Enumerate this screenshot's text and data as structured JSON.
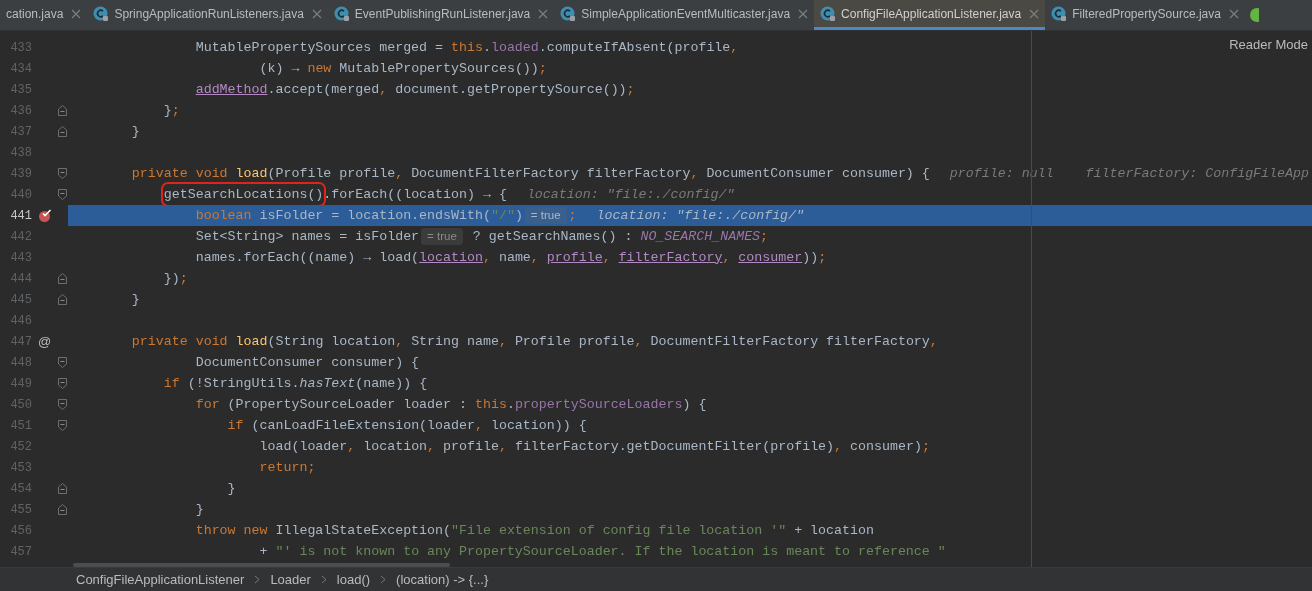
{
  "tabs": [
    {
      "label": "cation.java",
      "selected": false,
      "icon": false
    },
    {
      "label": "SpringApplicationRunListeners.java",
      "selected": false,
      "icon": true
    },
    {
      "label": "EventPublishingRunListener.java",
      "selected": false,
      "icon": true
    },
    {
      "label": "SimpleApplicationEventMulticaster.java",
      "selected": false,
      "icon": true
    },
    {
      "label": "ConfigFileApplicationListener.java",
      "selected": true,
      "icon": true
    },
    {
      "label": "FilteredPropertySource.java",
      "selected": false,
      "icon": true
    }
  ],
  "reader_mode": "Reader Mode",
  "lines": [
    {
      "number": "433",
      "highlighted": false,
      "tokens": [
        {
          "t": "                MutablePropertySources merged = ",
          "kind": "p"
        },
        {
          "t": "this",
          "kind": "kw"
        },
        {
          "t": ".",
          "kind": "p"
        },
        {
          "t": "loaded",
          "kind": "field"
        },
        {
          "t": ".computeIfAbsent(profile",
          "kind": "p"
        },
        {
          "t": ",",
          "kind": "kw"
        }
      ]
    },
    {
      "number": "434",
      "highlighted": false,
      "tokens": [
        {
          "t": "                        (k) → ",
          "kind": "p"
        },
        {
          "t": "new",
          "kind": "kw"
        },
        {
          "t": " MutablePropertySources())",
          "kind": "p"
        },
        {
          "t": ";",
          "kind": "kw"
        }
      ]
    },
    {
      "number": "435",
      "highlighted": false,
      "tokens": [
        {
          "t": "                addMethod",
          "kind": "u"
        },
        {
          "t": ".accept(merged",
          "kind": "p"
        },
        {
          "t": ",",
          "kind": "kw"
        },
        {
          "t": " document.getPropertySource())",
          "kind": "p"
        },
        {
          "t": ";",
          "kind": "kw"
        }
      ]
    },
    {
      "number": "436",
      "highlighted": false,
      "fold_end": true,
      "tokens": [
        {
          "t": "            }",
          "kind": "p"
        },
        {
          "t": ";",
          "kind": "kw"
        }
      ]
    },
    {
      "number": "437",
      "highlighted": false,
      "fold_end": true,
      "tokens": [
        {
          "t": "        }",
          "kind": "p"
        }
      ]
    },
    {
      "number": "438",
      "highlighted": false
    },
    {
      "number": "439",
      "highlighted": false,
      "fold_start": true,
      "tokens": [
        {
          "t": "        private void ",
          "kind": "kw"
        },
        {
          "t": "load",
          "kind": "decl"
        },
        {
          "t": "(Profile profile",
          "kind": "p"
        },
        {
          "t": ",",
          "kind": "kw"
        },
        {
          "t": " DocumentFilterFactory filterFactory",
          "kind": "p"
        },
        {
          "t": ",",
          "kind": "kw"
        },
        {
          "t": " DocumentConsumer consumer) {",
          "kind": "p"
        },
        {
          "t": "profile: null",
          "kind": "hint"
        },
        {
          "t": "filterFactory: ConfigFileApp",
          "kind": "hint"
        }
      ]
    },
    {
      "number": "440",
      "highlighted": false,
      "fold_start": true,
      "tokens": [
        {
          "t": "            getSearchLocations()",
          "kind": "p",
          "boxed": true
        },
        {
          "t": ".forEach((location) → {",
          "kind": "p"
        },
        {
          "t": "location: \"file:./config/\"",
          "kind": "hint"
        }
      ]
    },
    {
      "number": "441",
      "highlighted": true,
      "breakpoint": true,
      "tokens": [
        {
          "t": "                boolean",
          "kind": "kw"
        },
        {
          "t": " isFolder = location.endsWith(",
          "kind": "p"
        },
        {
          "t": "\"/\"",
          "kind": "str"
        },
        {
          "t": ")",
          "kind": "p"
        },
        {
          "t": "= true",
          "kind": "inlay"
        },
        {
          "t": ";",
          "kind": "kw"
        },
        {
          "t": "location: \"file:./config/\"",
          "kind": "hint"
        }
      ]
    },
    {
      "number": "442",
      "highlighted": false,
      "tokens": [
        {
          "t": "                Set<String> names = isFolder",
          "kind": "p"
        },
        {
          "t": "= true",
          "kind": "inlay"
        },
        {
          "t": " ? getSearchNames() : ",
          "kind": "p"
        },
        {
          "t": "NO_SEARCH_NAMES",
          "kind": "const"
        },
        {
          "t": ";",
          "kind": "kw"
        }
      ]
    },
    {
      "number": "443",
      "highlighted": false,
      "tokens": [
        {
          "t": "                names.forEach((name) → load(",
          "kind": "p"
        },
        {
          "t": "location",
          "kind": "u"
        },
        {
          "t": ",",
          "kind": "kw"
        },
        {
          "t": " name",
          "kind": "p"
        },
        {
          "t": ", ",
          "kind": "kw"
        },
        {
          "t": "profile",
          "kind": "u"
        },
        {
          "t": ", ",
          "kind": "kw"
        },
        {
          "t": "filterFactory",
          "kind": "u"
        },
        {
          "t": ", ",
          "kind": "kw"
        },
        {
          "t": "consumer",
          "kind": "u"
        },
        {
          "t": "))",
          "kind": "p"
        },
        {
          "t": ";",
          "kind": "kw"
        }
      ]
    },
    {
      "number": "444",
      "highlighted": false,
      "fold_end": true,
      "tokens": [
        {
          "t": "            })",
          "kind": "p"
        },
        {
          "t": ";",
          "kind": "kw"
        }
      ]
    },
    {
      "number": "445",
      "highlighted": false,
      "fold_end": true,
      "tokens": [
        {
          "t": "        }",
          "kind": "p"
        }
      ]
    },
    {
      "number": "446",
      "highlighted": false
    },
    {
      "number": "447",
      "highlighted": false,
      "gutter_text": "@",
      "tokens": [
        {
          "t": "        private void ",
          "kind": "kw"
        },
        {
          "t": "load",
          "kind": "decl"
        },
        {
          "t": "(String location",
          "kind": "p"
        },
        {
          "t": ",",
          "kind": "kw"
        },
        {
          "t": " String name",
          "kind": "p"
        },
        {
          "t": ",",
          "kind": "kw"
        },
        {
          "t": " Profile profile",
          "kind": "p"
        },
        {
          "t": ",",
          "kind": "kw"
        },
        {
          "t": " DocumentFilterFactory filterFactory",
          "kind": "p"
        },
        {
          "t": ",",
          "kind": "kw"
        }
      ]
    },
    {
      "number": "448",
      "highlighted": false,
      "fold_start": true,
      "tokens": [
        {
          "t": "                DocumentConsumer consumer) {",
          "kind": "p"
        }
      ]
    },
    {
      "number": "449",
      "highlighted": false,
      "fold_start": true,
      "tokens": [
        {
          "t": "            if",
          "kind": "kw"
        },
        {
          "t": " (!StringUtils.",
          "kind": "p"
        },
        {
          "t": "hasText",
          "kind": "static"
        },
        {
          "t": "(name)) {",
          "kind": "p"
        }
      ]
    },
    {
      "number": "450",
      "highlighted": false,
      "fold_start": true,
      "tokens": [
        {
          "t": "                for",
          "kind": "kw"
        },
        {
          "t": " (PropertySourceLoader loader : ",
          "kind": "p"
        },
        {
          "t": "this",
          "kind": "kw"
        },
        {
          "t": ".",
          "kind": "p"
        },
        {
          "t": "propertySourceLoaders",
          "kind": "field"
        },
        {
          "t": ") {",
          "kind": "p"
        }
      ]
    },
    {
      "number": "451",
      "highlighted": false,
      "fold_start": true,
      "tokens": [
        {
          "t": "                    if",
          "kind": "kw"
        },
        {
          "t": " (canLoadFileExtension(loader",
          "kind": "p"
        },
        {
          "t": ",",
          "kind": "kw"
        },
        {
          "t": " location)) {",
          "kind": "p"
        }
      ]
    },
    {
      "number": "452",
      "highlighted": false,
      "tokens": [
        {
          "t": "                        load(loader",
          "kind": "p"
        },
        {
          "t": ",",
          "kind": "kw"
        },
        {
          "t": " location",
          "kind": "p"
        },
        {
          "t": ",",
          "kind": "kw"
        },
        {
          "t": " profile",
          "kind": "p"
        },
        {
          "t": ",",
          "kind": "kw"
        },
        {
          "t": " filterFactory.getDocumentFilter(profile)",
          "kind": "p"
        },
        {
          "t": ",",
          "kind": "kw"
        },
        {
          "t": " consumer)",
          "kind": "p"
        },
        {
          "t": ";",
          "kind": "kw"
        }
      ]
    },
    {
      "number": "453",
      "highlighted": false,
      "tokens": [
        {
          "t": "                        return;",
          "kind": "kw"
        }
      ]
    },
    {
      "number": "454",
      "highlighted": false,
      "fold_end": true,
      "tokens": [
        {
          "t": "                    }",
          "kind": "p"
        }
      ]
    },
    {
      "number": "455",
      "highlighted": false,
      "fold_end": true,
      "tokens": [
        {
          "t": "                }",
          "kind": "p"
        }
      ]
    },
    {
      "number": "456",
      "highlighted": false,
      "tokens": [
        {
          "t": "                throw new ",
          "kind": "kw"
        },
        {
          "t": "IllegalStateException(",
          "kind": "p"
        },
        {
          "t": "\"File extension of config file location '\"",
          "kind": "str"
        },
        {
          "t": " + location",
          "kind": "p"
        }
      ]
    },
    {
      "number": "457",
      "highlighted": false,
      "tokens": [
        {
          "t": "                        + ",
          "kind": "p"
        },
        {
          "t": "\"' is not known to any PropertySourceLoader. If the location is meant to reference \"",
          "kind": "str"
        }
      ]
    }
  ],
  "breadcrumbs": [
    "ConfigFileApplicationListener",
    "Loader",
    "load()",
    "(location) -> {...}"
  ]
}
